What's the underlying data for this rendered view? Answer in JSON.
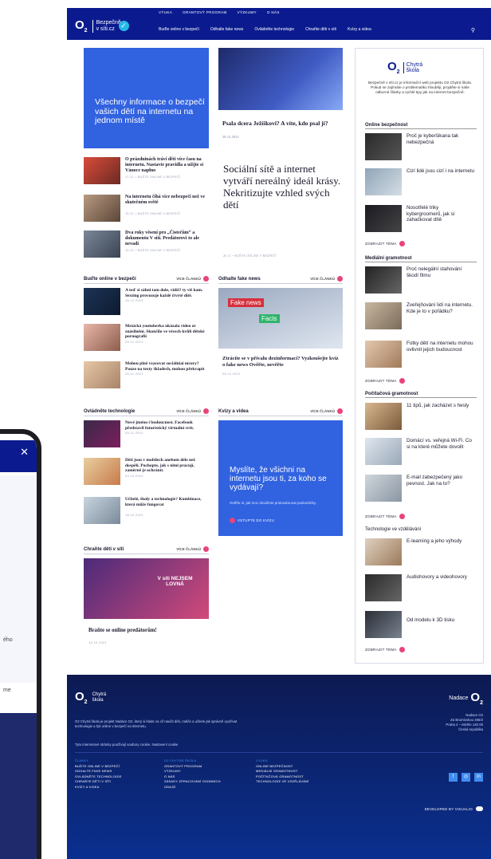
{
  "header": {
    "logo_text": "Bezpečně v síti.cz",
    "top_nav": [
      "VÝUKA",
      "GRANTOVÝ PROGRAM",
      "VÝZKUMY",
      "O NÁS"
    ],
    "main_nav": [
      "Buďte online v bezpečí",
      "Odhalte fake news",
      "Ovládněte technologie",
      "Chraňte děti v síti",
      "Kvízy a videa"
    ],
    "search_icon": "search-icon"
  },
  "hero": {
    "blue_text": "Všechny informace o bezpečí vašich dětí na internetu na jednom místě",
    "image_title": "Psala dcera Ježíškovi? A víte, kdo psal jí?",
    "image_date": "20.12.2021",
    "big_headline": "Sociální sítě a internet vytváří nereálný ideál krásy. Nekritizujte vzhled svých dětí",
    "big_tag": "26.11. • BUĎTE ONLINE V BEZPEČÍ"
  },
  "small_articles": [
    {
      "title": "O prázdninách tráví děti více času na internetu. Nastavte pravidla a užijte si Vánoce napłno",
      "tag": "17.12. • BUĎTE ONLINE V BEZPEČÍ"
    },
    {
      "title": "Na internetu číhá více nebezpečí než ve skutečném světě",
      "tag": "15.12. • BUĎTE ONLINE V BEZPEČÍ"
    },
    {
      "title": "Dva roky věsení pro „Čistečům“ a dokumentu V síti. Predátorovi to ale nevadí",
      "tag": "13.12. • BUĎTE ONLINE V BEZPEČÍ"
    }
  ],
  "sections": {
    "online": {
      "title": "Buďte online v bezpečí",
      "more": "VÍCE ČLÁNKŮ",
      "items": [
        {
          "title": "A teď si sáhni tam dole, vidíš? ty víš kam. Sexting provozuje každé čtvrté dítě.",
          "date": "16.12.2021"
        },
        {
          "title": "Mexická youtuberka ukázala video ze znásilnění. Skončilo ve věcech kvůli dětské pornografii",
          "date": "29.11.2021"
        },
        {
          "title": "Mohou plně vzacovat sociálníai nícory? Pouze na texty škladech, mohou překvapit",
          "date": "26.11.2021"
        }
      ]
    },
    "fake": {
      "title": "Odhalte fake news",
      "more": "VÍCE ČLÁNKŮ",
      "image_red": "Fake news",
      "image_green": "Facts",
      "headline": "Ztrácíte se v přívalu dezinformací? Vyzkoušejte kvíz o fake news Ověřte, nevěřte",
      "date": "26.11.2021"
    },
    "tech": {
      "title": "Ovládněte technologie",
      "more": "VÍCE ČLÁNKŮ",
      "items": [
        {
          "title": "Nové jméno i budoucnost. Facebook představil futuristický virtuální svět.",
          "date": "05.11.2021"
        },
        {
          "title": "Děti jsou v mobilech anebom déle než dospělí. Pochopte, jak s nimi pracují, zaměrně je ochránít.",
          "date": "20.10.2021"
        },
        {
          "title": "Učitelé, školy a technologie? Kombinace, která může fungovat",
          "date": "18.10.2021"
        }
      ]
    },
    "quiz": {
      "title": "Kvízy a videa",
      "more": "VÍCE ČLÁNKŮ",
      "question": "Myslíte, že všichni na internetu jsou ti, za koho se vydávají?",
      "desc": "Ověřte si, jak moc dovážete prokoukouvat podvodníky.",
      "button": "VSTUPTE DO KVÍZU"
    },
    "protect": {
      "title": "Chraňte děti v síti",
      "more": "VÍCE ČLÁNKŮ",
      "image_text": "V síti NEJSEM LOVNÁ",
      "headline": "Braňte se online predátorům!",
      "date": "19.10.2021"
    }
  },
  "sidebar": {
    "logo_text": "Chytrá škola",
    "desc": "Bezpečně v síti.cz je informační web projektu O2 Chytrá škola. Pokud se zajímáte o problematiku hlouběji, projděte si naše odborné články a rychlé tipy jak na internet bezpečně.",
    "show_label": "ZOBRAZIT TÉMA",
    "groups": [
      {
        "title": "Online bezpečnost",
        "items": [
          "Proč je kyberšikana tak nebezpečná",
          "Cizí lidé jsou cizí i na internetu",
          "Nosotřelé triky kybergroomerů, jak si zahačkovat dítě"
        ]
      },
      {
        "title": "Mediální gramotnost",
        "items": [
          "Proč nelegální stahování škodí filmu",
          "Zveřejňování lidí na internetu. Kde je to v pořádku?",
          "Fotky dětí na internetu mohou ovlivnit jejich budoucnost"
        ]
      },
      {
        "title": "Počítačová gramotnost",
        "items": [
          "11 tipů, jak zacházet s hesly",
          "Domácí vs. veřejná Wi-Fi. Co si na které můžete dovolit",
          "E-mail zabezpečený jako pevnost. Jak na to?"
        ]
      },
      {
        "title": "Technologie ve vzdělávání",
        "items": [
          "E-learning a jeho výhody",
          "Audiohovory a videohovory",
          "Od modelu k 3D tisku"
        ]
      }
    ]
  },
  "footer": {
    "logo_text": "Chytrá škola",
    "desc": "O2 Chytrá škola je projekt Nadace O2, který si klade za cíl naučit děti, rodiče a učitele jak správně využívat technologie a být online v bezpečí na internetu.",
    "cookie": "Tyto internetové stránky používají soubory cookie. Nastavení cookie",
    "col1_head": "ČLÁNKY",
    "col1": [
      "BUĎTE ONLINE V BEZPEČÍ",
      "ODHALTE FAKE NEWS",
      "OVLÁDNĚTE TECHNOLOGIE",
      "CHRAŇTE DĚTI V SÍTI",
      "KVÍZY A VIDEA"
    ],
    "col2_head": "O2 CHYTRÁ ŠKOLA",
    "col2": [
      "GRANTOVÝ PROGRAM",
      "VÝZKUMY",
      "O NÁS",
      "ZÁSADY ZPRACOVÁNÍ OSOBNÍCH ÚDAJŮ"
    ],
    "col3_head": "VÝUKA",
    "col3": [
      "ONLINE BEZPEČNOST",
      "MEDIÁLNÍ GRAMOTNOST",
      "POČÍTAČOVÁ GRAMOTNOST",
      "TECHNOLOGIE VE VZDĚLÁVÁNÍ"
    ],
    "nadace": "Nadace",
    "address": [
      "Nadace O2",
      "Za Brumlovkou 266/2",
      "Praha 4 – Michle 140 00",
      "Česká republika"
    ],
    "developed": "DEVELOPED BY VISUALIO"
  },
  "phone": {
    "text1": "ého",
    "text2": "me"
  },
  "colors": {
    "nav": "#0b1b8f",
    "accent_blue": "#3162e0",
    "pink": "#e8447a",
    "footer": "#0a2f8f"
  }
}
